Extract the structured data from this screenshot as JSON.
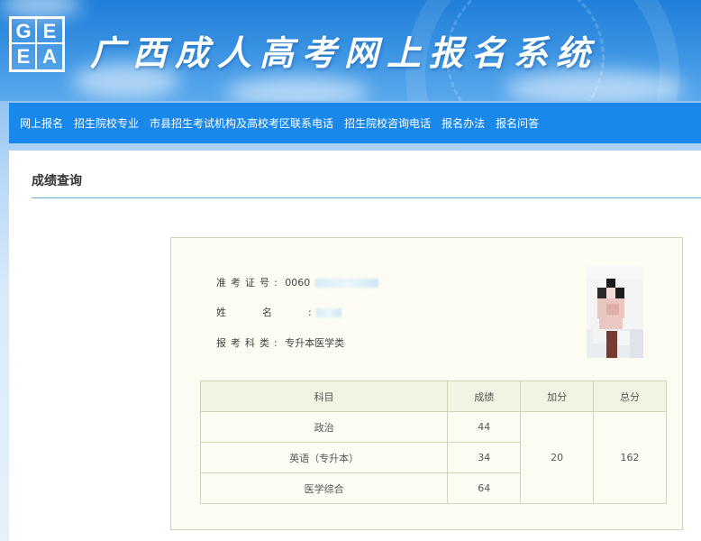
{
  "header": {
    "logo_letters": [
      "G",
      "E",
      "E",
      "A"
    ],
    "site_title": "广西成人高考网上报名系统"
  },
  "nav": {
    "items": [
      "网上报名",
      "招生院校专业",
      "市县招生考试机构及高校考区联系电话",
      "招生院校咨询电话",
      "报名办法",
      "报名问答"
    ]
  },
  "page": {
    "section_title": "成绩查询"
  },
  "candidate": {
    "exam_no_label": "准考证号:",
    "exam_no_value": "0060",
    "name_label": "姓名",
    "name_colon": ":",
    "category_label": "报考科类:",
    "category_value": "专升本医学类"
  },
  "scores": {
    "headers": [
      "科目",
      "成绩",
      "加分",
      "总分"
    ],
    "rows": [
      {
        "subject": "政治",
        "score": "44"
      },
      {
        "subject": "英语（专升本）",
        "score": "34"
      },
      {
        "subject": "医学综合",
        "score": "64"
      }
    ],
    "bonus": "20",
    "total": "162"
  },
  "colors": {
    "header_blue": "#1f7fd9",
    "nav_blue": "#1a88ea",
    "panel_bg": "#fcfcf3",
    "rule_blue": "#6aa4dd"
  }
}
